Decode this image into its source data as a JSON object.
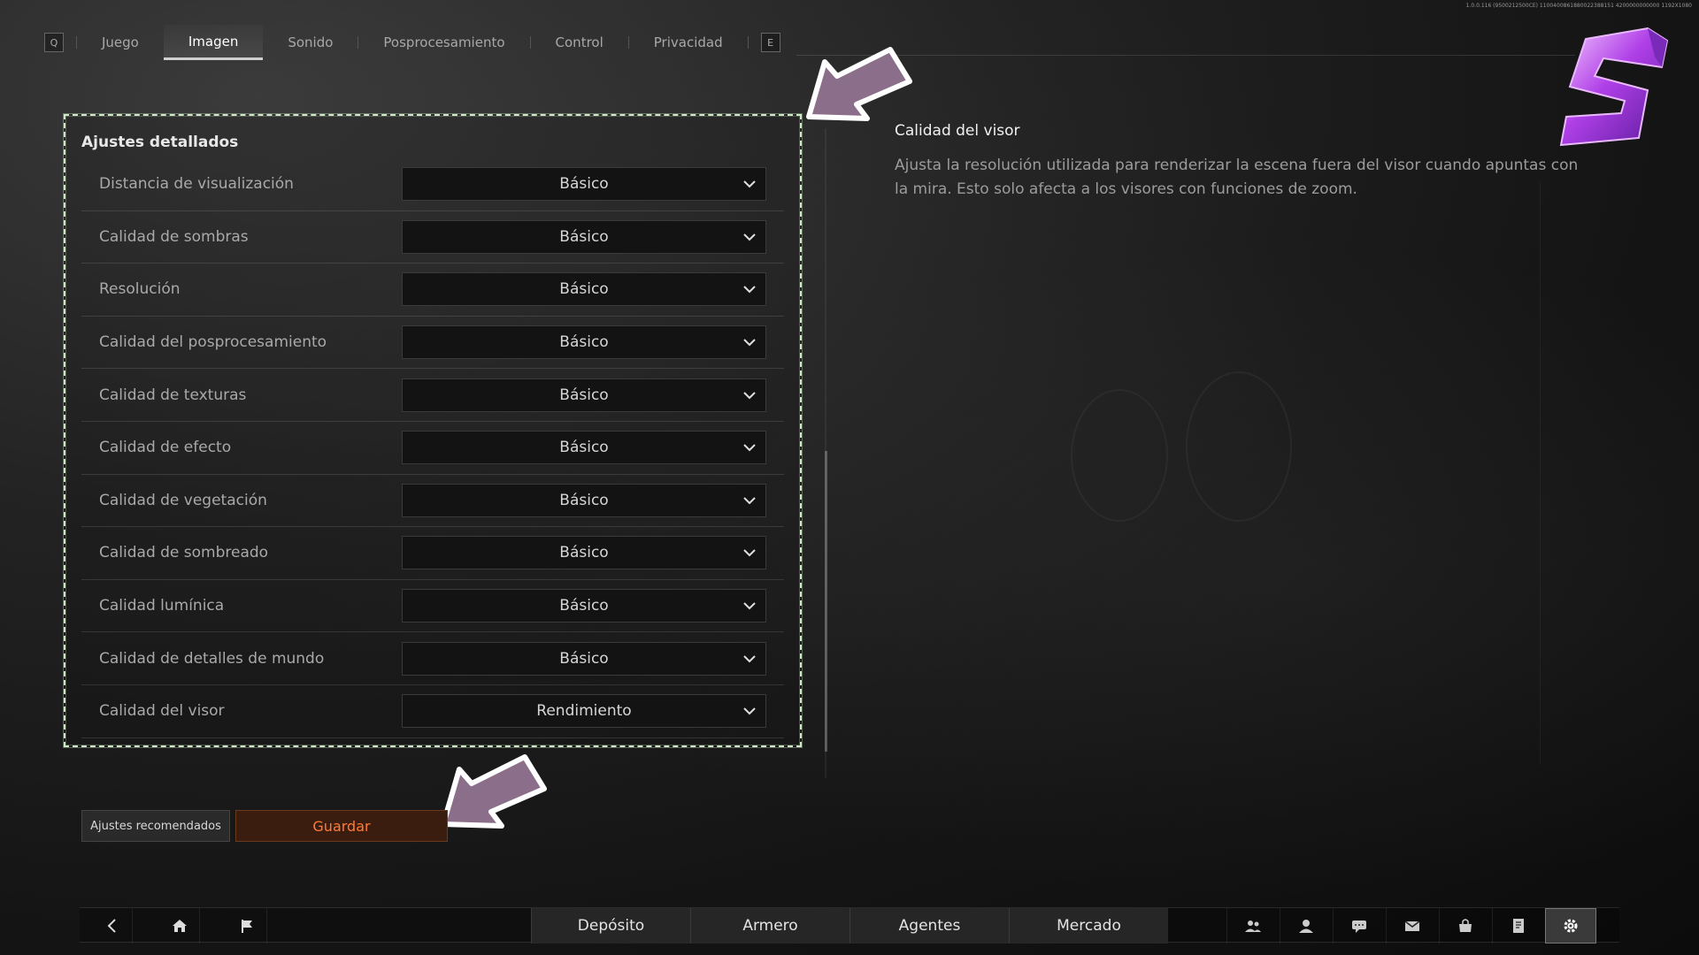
{
  "version": "1.0.0.116 (9500212500CE) 1100400861880022388151 4200000000000 1192X1080",
  "tabs": {
    "left_key": "Q",
    "right_key": "E",
    "items": [
      "Juego",
      "Imagen",
      "Sonido",
      "Posprocesamiento",
      "Control",
      "Privacidad"
    ],
    "active": "Imagen"
  },
  "panel": {
    "title": "Ajustes detallados",
    "rows": [
      {
        "label": "Distancia de visualización",
        "value": "Básico"
      },
      {
        "label": "Calidad de sombras",
        "value": "Básico"
      },
      {
        "label": "Resolución",
        "value": "Básico"
      },
      {
        "label": "Calidad del posprocesamiento",
        "value": "Básico"
      },
      {
        "label": "Calidad de texturas",
        "value": "Básico"
      },
      {
        "label": "Calidad de efecto",
        "value": "Básico"
      },
      {
        "label": "Calidad de vegetación",
        "value": "Básico"
      },
      {
        "label": "Calidad de sombreado",
        "value": "Básico"
      },
      {
        "label": "Calidad lumínica",
        "value": "Básico"
      },
      {
        "label": "Calidad de detalles de mundo",
        "value": "Básico"
      },
      {
        "label": "Calidad del visor",
        "value": "Rendimiento"
      }
    ]
  },
  "buttons": {
    "recommended": "Ajustes recomendados",
    "save": "Guardar"
  },
  "description": {
    "title": "Calidad del visor",
    "text": "Ajusta la resolución utilizada para renderizar la escena fuera del visor cuando apuntas con la mira. Esto solo afecta a los visores con funciones de zoom."
  },
  "bottom": {
    "tabs": [
      "Depósito",
      "Armero",
      "Agentes",
      "Mercado"
    ],
    "left_icons": [
      "back-icon",
      "home-icon",
      "flag-icon"
    ],
    "right_icons": [
      "friends-icon",
      "profile-icon",
      "chat-icon",
      "mail-icon",
      "shop-icon",
      "notes-icon",
      "gear-icon"
    ]
  },
  "colors": {
    "save_text": "#ff7b35",
    "arrow_fill": "#8a6e8a",
    "highlight_border": "#cfe8c8"
  }
}
